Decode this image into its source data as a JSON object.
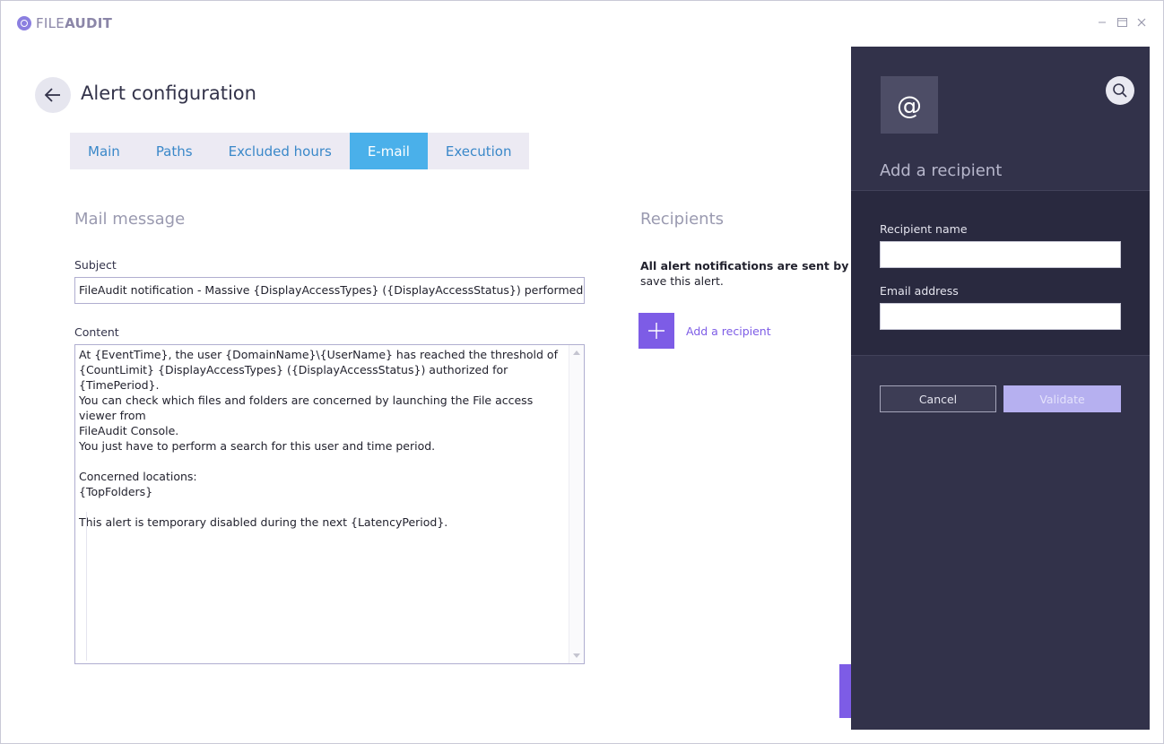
{
  "app": {
    "logo_prefix": "FILE",
    "logo_suffix": "AUDIT",
    "window_controls": [
      "minimize-icon",
      "maximize-icon",
      "close-icon"
    ]
  },
  "header": {
    "back_icon": "arrow-left-icon",
    "title": "Alert configuration"
  },
  "tabs": [
    {
      "label": "Main",
      "active": false
    },
    {
      "label": "Paths",
      "active": false
    },
    {
      "label": "Excluded hours",
      "active": false
    },
    {
      "label": "E-mail",
      "active": true
    },
    {
      "label": "Execution",
      "active": false
    }
  ],
  "mail": {
    "section_title": "Mail message",
    "subject_label": "Subject",
    "subject_value": "FileAudit notification - Massive {DisplayAccessTypes} ({DisplayAccessStatus}) performed by {DomainName}\\{UserName}",
    "content_label": "Content",
    "content_value": "At {EventTime}, the user {DomainName}\\{UserName} has reached the threshold of\n{CountLimit} {DisplayAccessTypes} ({DisplayAccessStatus}) authorized for {TimePeriod}.\nYou can check which files and folders are concerned by launching the File access viewer from\nFileAudit Console.\nYou just have to perform a search for this user and time period.\n\nConcerned locations:\n{TopFolders}\n\nThis alert is temporary disabled during the next {LatencyPeriod}."
  },
  "recipients": {
    "section_title": "Recipients",
    "note_bold": "All alert notifications are sent by emai",
    "note_rest": "save this alert.",
    "add_label": "Add a recipient"
  },
  "panel": {
    "icon_glyph": "@",
    "title": "Add a recipient",
    "name_label": "Recipient name",
    "name_value": "",
    "email_label": "Email address",
    "email_value": "",
    "cancel_label": "Cancel",
    "validate_label": "Validate"
  },
  "colors": {
    "accent_purple": "#7d5ce6",
    "tab_active": "#4ab0ea",
    "panel_bg": "#32324a",
    "validate_bg": "#b6b0f0"
  }
}
